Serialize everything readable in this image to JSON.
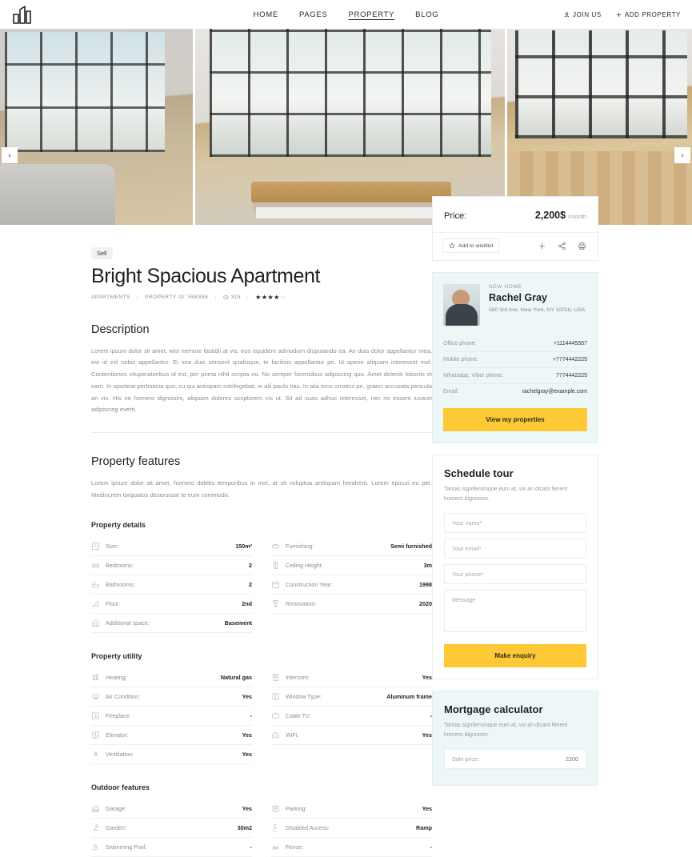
{
  "header": {
    "logo_name": "building-logo",
    "nav": [
      {
        "label": "HOME",
        "active": false
      },
      {
        "label": "PAGES",
        "active": false
      },
      {
        "label": "PROPERTY",
        "active": true
      },
      {
        "label": "BLOG",
        "active": false
      }
    ],
    "join_us": "JOIN US",
    "add_property": "ADD PROPERTY"
  },
  "slider": {
    "prev": "‹",
    "next": "›",
    "slides": [
      {
        "alt": "living room with sofa and large windows"
      },
      {
        "alt": "open kitchen with wooden island"
      },
      {
        "alt": "loft interior with wooden floor"
      }
    ]
  },
  "listing": {
    "badge": "Sell",
    "title": "Bright Spacious Apartment",
    "category": "APARTMENTS",
    "property_id": "PROPERTY ID: 55K886",
    "views": "315",
    "rating": 4,
    "rating_max": 5
  },
  "description": {
    "heading": "Description",
    "text": "Lorem ipsum dolor sit amet, wisi nemore fastidii at vis, eos equidem admodum disputando ea. An duis dolor appellantur mea, est id zril nobis appellantur. Ei sea duis senserit qualisque, te facilisis appellantur pri. Id aperiri aliquam interesset mel. Contentiones vituperatoribus id est, per prima nihil scripta no. No semper forensibus adipiscing quo. Amet deleniti lobortis et eam. In oporteat pertinacia quo, cu qui antiopam intellegebat, ei alii paulo has. In alia eros ornatus pri, graeci accusata pericula an vix. His ne homero dignissim, aliquam dolores scriptorem vis ut. Sit ad suas adhuc interesset, nec no essent iuvaret adipiscing everti."
  },
  "features": {
    "heading": "Property features",
    "text": "Lorem ipsum dolor sit amet, homero debitis temporibus in mei, at sit voluptua antiopam hendrerit. Lorem epicuri eu per. Mediocrem torquatos deseruisse te eum commodo.",
    "details_title": "Property details",
    "details_left": [
      {
        "icon": "size-icon",
        "label": "Size:",
        "value": "150m²"
      },
      {
        "icon": "bed-icon",
        "label": "Bedrooms:",
        "value": "2"
      },
      {
        "icon": "bathtub-icon",
        "label": "Bathrooms:",
        "value": "2"
      },
      {
        "icon": "stairs-icon",
        "label": "Floor:",
        "value": "2nd"
      },
      {
        "icon": "basement-icon",
        "label": "Additional space:",
        "value": "Basement"
      }
    ],
    "details_right": [
      {
        "icon": "sofa-icon",
        "label": "Furnishing:",
        "value": "Semi furnished"
      },
      {
        "icon": "ruler-icon",
        "label": "Ceiling Height:",
        "value": "3m"
      },
      {
        "icon": "calendar-icon",
        "label": "Construction Year:",
        "value": "1998"
      },
      {
        "icon": "paint-roller-icon",
        "label": "Renovation:",
        "value": "2020"
      }
    ],
    "utility_title": "Property utility",
    "utility_left": [
      {
        "icon": "radiator-icon",
        "label": "Heating:",
        "value": "Natural gas"
      },
      {
        "icon": "air-conditioner-icon",
        "label": "Air Condition:",
        "value": "Yes"
      },
      {
        "icon": "fireplace-icon",
        "label": "Fireplace:",
        "value": "-"
      },
      {
        "icon": "elevator-icon",
        "label": "Elevator:",
        "value": "Yes"
      },
      {
        "icon": "fan-icon",
        "label": "Ventilation:",
        "value": "Yes"
      }
    ],
    "utility_right": [
      {
        "icon": "intercom-icon",
        "label": "Intercom:",
        "value": "Yes"
      },
      {
        "icon": "window-icon",
        "label": "Window Type:",
        "value": "Aluminum frame"
      },
      {
        "icon": "tv-icon",
        "label": "Cable TV:",
        "value": "-"
      },
      {
        "icon": "wifi-icon",
        "label": "WiFi:",
        "value": "Yes"
      }
    ],
    "outdoor_title": "Outdoor features",
    "outdoor_left": [
      {
        "icon": "garage-icon",
        "label": "Garage:",
        "value": "Yes"
      },
      {
        "icon": "garden-icon",
        "label": "Garden:",
        "value": "30m2"
      },
      {
        "icon": "pool-icon",
        "label": "Swimming Pool:",
        "value": "-"
      }
    ],
    "outdoor_right": [
      {
        "icon": "parking-icon",
        "label": "Parking:",
        "value": "Yes"
      },
      {
        "icon": "wheelchair-icon",
        "label": "Disabled Access:",
        "value": "Ramp"
      },
      {
        "icon": "fence-icon",
        "label": "Fence:",
        "value": "-"
      }
    ]
  },
  "price_card": {
    "label": "Price:",
    "amount": "2,200$",
    "period": "/month",
    "wishlist": "Add to wishlist",
    "actions": [
      {
        "icon": "plus-icon",
        "glyph": "+"
      },
      {
        "icon": "share-icon",
        "glyph": ""
      },
      {
        "icon": "print-icon",
        "glyph": ""
      }
    ]
  },
  "agent": {
    "subtitle": "NEW HOME",
    "name": "Rachel Gray",
    "address": "560 3rd Ave, New York, NY 10016, USA",
    "contacts": [
      {
        "label": "Office phone:",
        "value": "+1114445557"
      },
      {
        "label": "Mobile phone:",
        "value": "+7774442225"
      },
      {
        "label": "Whatsapp, Viber phone:",
        "value": "7774442225"
      },
      {
        "label": "Email:",
        "value": "rachelgray@example.com"
      }
    ],
    "cta": "View my properties"
  },
  "schedule_tour": {
    "title": "Schedule tour",
    "desc": "Tantas signiferumque eum at, vix an dicant fierent homero dignissim.",
    "name_placeholder": "Your name*",
    "email_placeholder": "Your email*",
    "phone_placeholder": "Your phone*",
    "message_placeholder": "Message",
    "submit": "Make enquiry"
  },
  "mortgage": {
    "title": "Mortgage calculator",
    "desc": "Tantas signiferumque eum at, vix an dicant fierent homero dignissim.",
    "sale_price_label": "Sale price:",
    "sale_price_value": "2200"
  },
  "colors": {
    "accent_yellow": "#fdc934",
    "mint": "#eef7f7",
    "text_dark": "#1f1f1f",
    "text_muted": "#8e8e8e"
  }
}
